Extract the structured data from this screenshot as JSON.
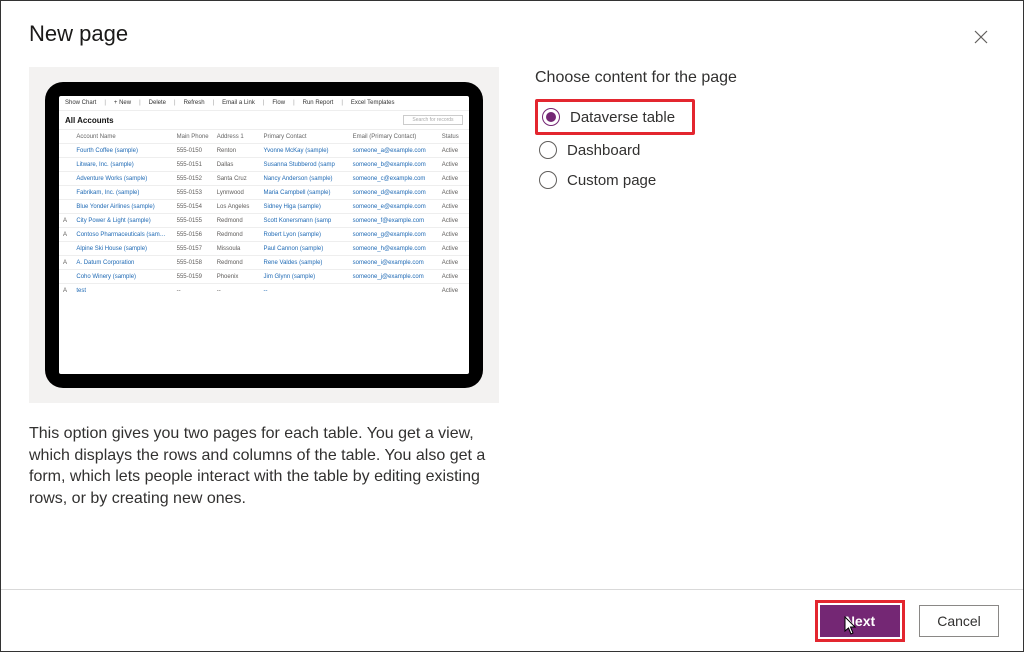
{
  "dialog": {
    "title": "New page",
    "description": "This option gives you two pages for each table. You get a view, which displays the rows and columns of the table. You also get a form, which lets people interact with the table by editing existing rows, or by creating new ones."
  },
  "content": {
    "heading": "Choose content for the page",
    "options": {
      "dataverse": "Dataverse table",
      "dashboard": "Dashboard",
      "custom": "Custom page"
    }
  },
  "footer": {
    "next": "Next",
    "cancel": "Cancel"
  },
  "preview": {
    "toolbar": [
      "Show Chart",
      "+ New",
      "Delete",
      "Refresh",
      "Email a Link",
      "Flow",
      "Run Report",
      "Excel Templates"
    ],
    "heading": "All Accounts",
    "search_placeholder": "Search for records",
    "columns": [
      "",
      "Account Name",
      "Main Phone",
      "Address 1",
      "Primary Contact",
      "Email (Primary Contact)",
      "Status"
    ],
    "rows": [
      [
        "",
        "Fourth Coffee (sample)",
        "555-0150",
        "Renton",
        "Yvonne McKay (sample)",
        "someone_a@example.com",
        "Active"
      ],
      [
        "",
        "Litware, Inc. (sample)",
        "555-0151",
        "Dallas",
        "Susanna Stubberod (samp",
        "someone_b@example.com",
        "Active"
      ],
      [
        "",
        "Adventure Works (sample)",
        "555-0152",
        "Santa Cruz",
        "Nancy Anderson (sample)",
        "someone_c@example.com",
        "Active"
      ],
      [
        "",
        "Fabrikam, Inc. (sample)",
        "555-0153",
        "Lynnwood",
        "Maria Campbell (sample)",
        "someone_d@example.com",
        "Active"
      ],
      [
        "",
        "Blue Yonder Airlines (sample)",
        "555-0154",
        "Los Angeles",
        "Sidney Higa (sample)",
        "someone_e@example.com",
        "Active"
      ],
      [
        "A",
        "City Power & Light (sample)",
        "555-0155",
        "Redmond",
        "Scott Konersmann (samp",
        "someone_f@example.com",
        "Active"
      ],
      [
        "A",
        "Contoso Pharmaceuticals (sample)",
        "555-0156",
        "Redmond",
        "Robert Lyon (sample)",
        "someone_g@example.com",
        "Active"
      ],
      [
        "",
        "Alpine Ski House (sample)",
        "555-0157",
        "Missoula",
        "Paul Cannon (sample)",
        "someone_h@example.com",
        "Active"
      ],
      [
        "A",
        "A. Datum Corporation",
        "555-0158",
        "Redmond",
        "Rene Valdes (sample)",
        "someone_i@example.com",
        "Active"
      ],
      [
        "",
        "Coho Winery (sample)",
        "555-0159",
        "Phoenix",
        "Jim Glynn (sample)",
        "someone_j@example.com",
        "Active"
      ],
      [
        "A",
        "test",
        "--",
        "--",
        "--",
        "",
        "Active"
      ]
    ]
  }
}
